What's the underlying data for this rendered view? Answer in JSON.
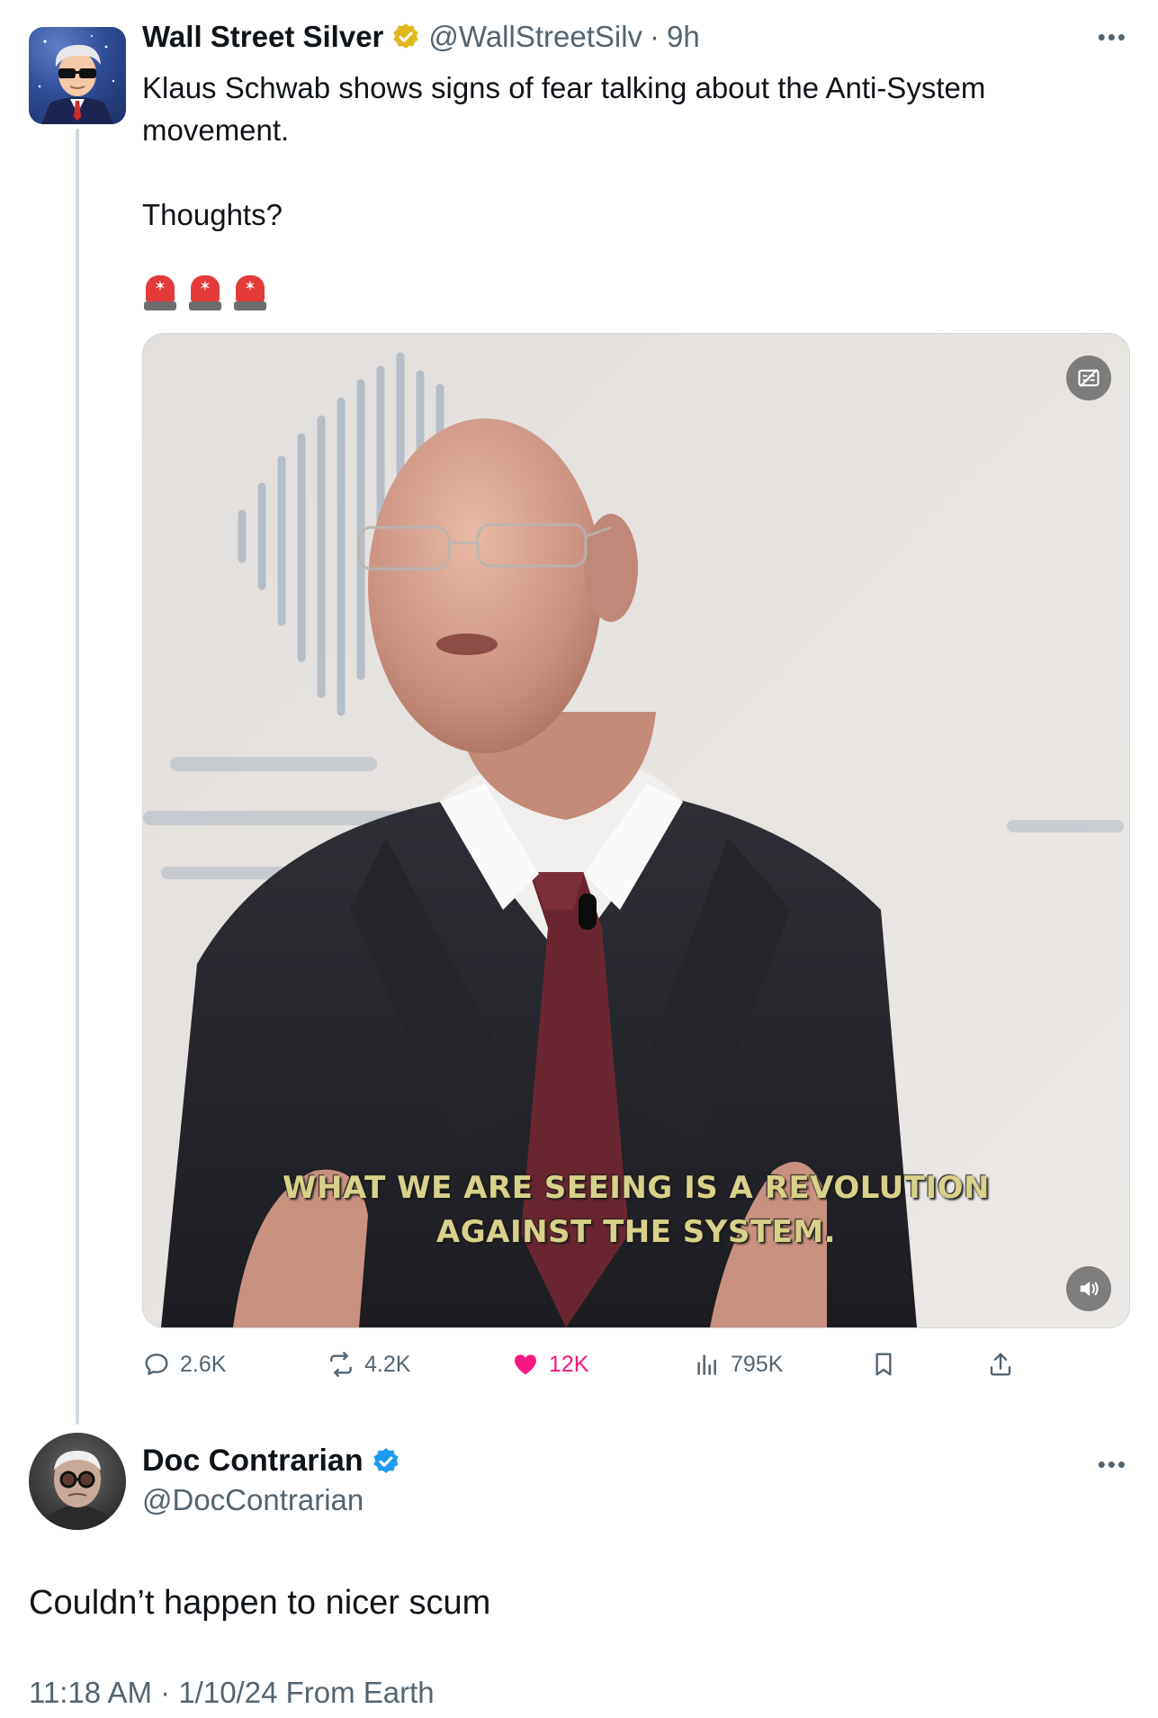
{
  "post": {
    "author": {
      "display_name": "Wall Street Silver",
      "handle": "@WallStreetSilv",
      "separator": "·",
      "time_ago": "9h",
      "verified": "gold",
      "avatar_icon": "wsb-guy-avatar"
    },
    "text": "Klaus Schwab shows signs of fear talking about the Anti-System\nmovement.\n\nThoughts?",
    "emojis": [
      "police-light-emoji",
      "police-light-emoji",
      "police-light-emoji"
    ],
    "media": {
      "type": "video",
      "caption": "WHAT WE ARE SEEING IS A REVOLUTION\nAGAINST THE SYSTEM.",
      "top_button_icon": "no-captions-icon",
      "bottom_button_icon": "volume-icon"
    },
    "metrics": {
      "replies": "2.6K",
      "reposts": "4.2K",
      "likes": "12K",
      "views": "795K"
    },
    "more_icon": "more-dots-icon"
  },
  "reply": {
    "author": {
      "display_name": "Doc Contrarian",
      "handle": "@DocContrarian",
      "verified": "blue",
      "avatar_icon": "doc-contrarian-avatar"
    },
    "text": "Couldn’t happen to nicer scum",
    "time": "11:18 AM",
    "separator": "·",
    "date": "1/10/24",
    "source": "From Earth"
  },
  "colors": {
    "text_primary": "#0f1419",
    "text_secondary": "#536471",
    "like_pink": "#f91880",
    "verified_blue": "#1d9bf0",
    "verified_gold": "#e2b719",
    "thread_line": "#cfd9de"
  }
}
